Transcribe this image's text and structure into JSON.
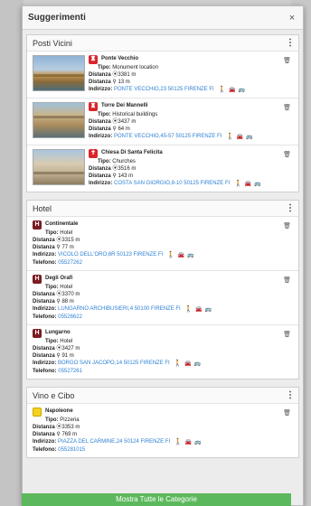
{
  "modal": {
    "title": "Suggerimenti",
    "close_icon": "close-icon"
  },
  "sections": {
    "posti": {
      "title": "Posti Vicini",
      "items": [
        {
          "name": "Ponte Vecchio",
          "tipo_label": "Tipo:",
          "tipo": "Monument location",
          "distanza_label": "Distanza",
          "distanza_time": "3381 m",
          "distanza_pin": "13 m",
          "indirizzo_label": "Indirizzo:",
          "indirizzo": "PONTE VECCHIO,23 50125 FIRENZE FI"
        },
        {
          "name": "Torre Dei Mannelli",
          "tipo_label": "Tipo:",
          "tipo": "Historical buildings",
          "distanza_label": "Distanza",
          "distanza_time": "3437 m",
          "distanza_pin": "64 m",
          "indirizzo_label": "Indirizzo:",
          "indirizzo": "PONTE VECCHIO,45-57 50125 FIRENZE FI"
        },
        {
          "name": "Chiesa Di Santa Felicita",
          "tipo_label": "Tipo:",
          "tipo": "Churches",
          "distanza_label": "Distanza",
          "distanza_time": "3516 m",
          "distanza_pin": "143 m",
          "indirizzo_label": "Indirizzo:",
          "indirizzo": "COSTA SAN GIORGIO,8-10 50125 FIRENZE FI"
        }
      ]
    },
    "hotel": {
      "title": "Hotel",
      "items": [
        {
          "name": "Continentale",
          "tipo_label": "Tipo:",
          "tipo": "Hotel",
          "distanza_label": "Distanza",
          "distanza_time": "3315 m",
          "distanza_pin": "77 m",
          "indirizzo_label": "Indirizzo:",
          "indirizzo": "VICOLO DELL'ORO,6R 50123 FIRENZE FI",
          "telefono_label": "Telefono:",
          "telefono": "05527262"
        },
        {
          "name": "Degli Orafi",
          "tipo_label": "Tipo:",
          "tipo": "Hotel",
          "distanza_label": "Distanza",
          "distanza_time": "3370 m",
          "distanza_pin": "88 m",
          "indirizzo_label": "Indirizzo:",
          "indirizzo": "LUNGARNO ARCHIBUSIERI,4 50100 FIRENZE FI",
          "telefono_label": "Telefono:",
          "telefono": "05526622"
        },
        {
          "name": "Lungarno",
          "tipo_label": "Tipo:",
          "tipo": "Hotel",
          "distanza_label": "Distanza",
          "distanza_time": "3427 m",
          "distanza_pin": "91 m",
          "indirizzo_label": "Indirizzo:",
          "indirizzo": "BORGO SAN JACOPO,14 50125 FIRENZE FI",
          "telefono_label": "Telefono:",
          "telefono": "05527261"
        }
      ]
    },
    "vino": {
      "title": "Vino e Cibo",
      "items": [
        {
          "name": "Napoleone",
          "tipo_label": "Tipo:",
          "tipo": "Pizzeria",
          "distanza_label": "Distanza",
          "distanza_time": "3353 m",
          "distanza_pin": "769 m",
          "indirizzo_label": "Indirizzo:",
          "indirizzo": "PIAZZA DEL CARMINE,24 50124 FIRENZE FI",
          "telefono_label": "Telefono:",
          "telefono": "055281015"
        }
      ]
    }
  },
  "footer": {
    "button_label": "Mostra Tutte le Categorie"
  },
  "colors": {
    "link": "#2d7fd3",
    "monument_red": "#d9252b",
    "hotel_maroon": "#7a1c22",
    "food_yellow": "#f4d21c",
    "footer_green": "#5cb85c"
  }
}
